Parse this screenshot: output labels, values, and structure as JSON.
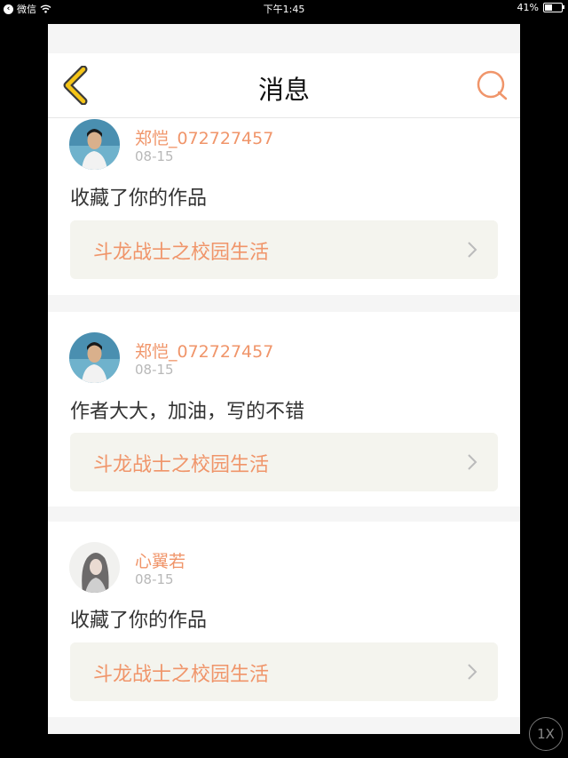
{
  "status_bar": {
    "back_app": "微信",
    "time": "下午1:45",
    "battery": "41%",
    "battery_level": 0.41
  },
  "nav": {
    "title": "消息",
    "back_icon": "chevron-left-icon",
    "search_icon": "search-icon"
  },
  "messages": [
    {
      "username": "郑恺_072727457",
      "date": "08-15",
      "text": "收藏了你的作品",
      "work_title": "斗龙战士之校园生活",
      "avatar": "male-avatar"
    },
    {
      "username": "郑恺_072727457",
      "date": "08-15",
      "text": "作者大大，加油，写的不错",
      "work_title": "斗龙战士之校园生活",
      "avatar": "male-avatar"
    },
    {
      "username": "心翼若",
      "date": "08-15",
      "text": "收藏了你的作品",
      "work_title": "斗龙战士之校园生活",
      "avatar": "female-avatar"
    }
  ],
  "zoom_button": "1X",
  "colors": {
    "accent": "#f0956a",
    "nav_back": "#f5c518",
    "work_box_bg": "#f4f4ee"
  }
}
